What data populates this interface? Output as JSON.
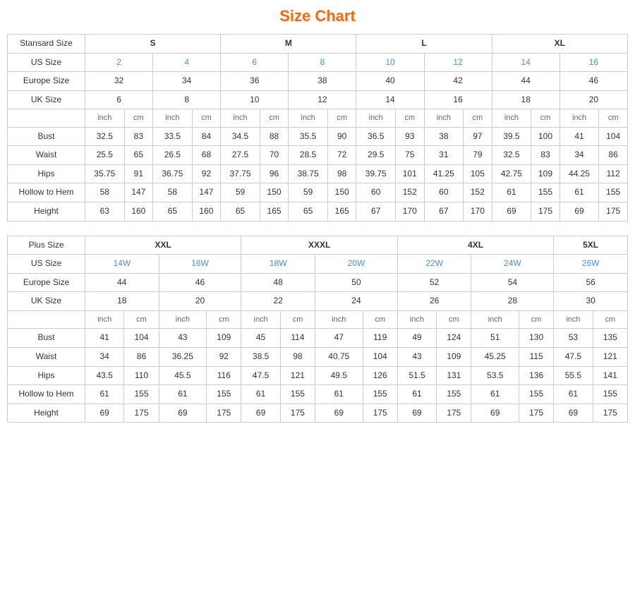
{
  "title": "Size Chart",
  "standard": {
    "table_title": "Stansard Size",
    "size_groups": [
      "S",
      "M",
      "L",
      "XL"
    ],
    "us_sizes": [
      "2",
      "4",
      "6",
      "8",
      "10",
      "12",
      "14",
      "16"
    ],
    "europe_sizes": [
      "32",
      "34",
      "36",
      "38",
      "40",
      "42",
      "44",
      "46"
    ],
    "uk_sizes": [
      "6",
      "8",
      "10",
      "12",
      "14",
      "16",
      "18",
      "20"
    ],
    "subheader": [
      "inch",
      "cm",
      "inch",
      "cm",
      "inch",
      "cm",
      "inch",
      "cm",
      "inch",
      "cm",
      "inch",
      "cm",
      "inch",
      "cm",
      "inch",
      "cm"
    ],
    "measurements": [
      {
        "label": "Bust",
        "vals": [
          "32.5",
          "83",
          "33.5",
          "84",
          "34.5",
          "88",
          "35.5",
          "90",
          "36.5",
          "93",
          "38",
          "97",
          "39.5",
          "100",
          "41",
          "104"
        ]
      },
      {
        "label": "Waist",
        "vals": [
          "25.5",
          "65",
          "26.5",
          "68",
          "27.5",
          "70",
          "28.5",
          "72",
          "29.5",
          "75",
          "31",
          "79",
          "32.5",
          "83",
          "34",
          "86"
        ]
      },
      {
        "label": "Hips",
        "vals": [
          "35.75",
          "91",
          "36.75",
          "92",
          "37.75",
          "96",
          "38.75",
          "98",
          "39.75",
          "101",
          "41.25",
          "105",
          "42.75",
          "109",
          "44.25",
          "112"
        ]
      },
      {
        "label": "Hollow to Hem",
        "vals": [
          "58",
          "147",
          "58",
          "147",
          "59",
          "150",
          "59",
          "150",
          "60",
          "152",
          "60",
          "152",
          "61",
          "155",
          "61",
          "155"
        ]
      },
      {
        "label": "Height",
        "vals": [
          "63",
          "160",
          "65",
          "160",
          "65",
          "165",
          "65",
          "165",
          "67",
          "170",
          "67",
          "170",
          "69",
          "175",
          "69",
          "175"
        ]
      }
    ]
  },
  "plus": {
    "table_title": "Plus Size",
    "size_groups": [
      "XXL",
      "XXXL",
      "4XL",
      "5XL"
    ],
    "us_sizes": [
      "14W",
      "16W",
      "18W",
      "20W",
      "22W",
      "24W",
      "26W"
    ],
    "europe_sizes": [
      "44",
      "46",
      "48",
      "50",
      "52",
      "54",
      "56"
    ],
    "uk_sizes": [
      "18",
      "20",
      "22",
      "24",
      "26",
      "28",
      "30"
    ],
    "subheader": [
      "inch",
      "cm",
      "inch",
      "cm",
      "inch",
      "cm",
      "inch",
      "cm",
      "inch",
      "cm",
      "inch",
      "cm",
      "inch",
      "cm"
    ],
    "measurements": [
      {
        "label": "Bust",
        "vals": [
          "41",
          "104",
          "43",
          "109",
          "45",
          "114",
          "47",
          "119",
          "49",
          "124",
          "51",
          "130",
          "53",
          "135"
        ]
      },
      {
        "label": "Waist",
        "vals": [
          "34",
          "86",
          "36.25",
          "92",
          "38.5",
          "98",
          "40.75",
          "104",
          "43",
          "109",
          "45.25",
          "115",
          "47.5",
          "121"
        ]
      },
      {
        "label": "Hips",
        "vals": [
          "43.5",
          "110",
          "45.5",
          "116",
          "47.5",
          "121",
          "49.5",
          "126",
          "51.5",
          "131",
          "53.5",
          "136",
          "55.5",
          "141"
        ]
      },
      {
        "label": "Hollow to Hem",
        "vals": [
          "61",
          "155",
          "61",
          "155",
          "61",
          "155",
          "61",
          "155",
          "61",
          "155",
          "61",
          "155",
          "61",
          "155"
        ]
      },
      {
        "label": "Height",
        "vals": [
          "69",
          "175",
          "69",
          "175",
          "69",
          "175",
          "69",
          "175",
          "69",
          "175",
          "69",
          "175",
          "69",
          "175"
        ]
      }
    ]
  }
}
